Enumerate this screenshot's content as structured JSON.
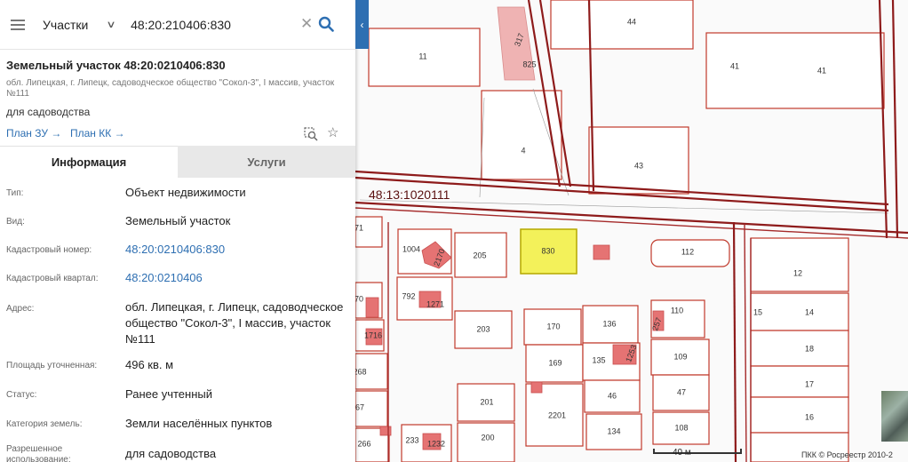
{
  "search": {
    "layer": "Участки",
    "query": "48:20:210406:830"
  },
  "parcel": {
    "title": "Земельный участок 48:20:0210406:830",
    "address_short": "обл. Липецкая, г. Липецк, садоводческое общество \"Сокол-3\", I массив, участок №111",
    "purpose": "для садоводства",
    "plan_zu": "План ЗУ",
    "plan_kk": "План КК"
  },
  "tabs": {
    "info": "Информация",
    "services": "Услуги"
  },
  "info_rows": [
    {
      "key": "Тип:",
      "value": "Объект недвижимости"
    },
    {
      "key": "Вид:",
      "value": "Земельный участок"
    },
    {
      "key": "Кадастровый номер:",
      "value": "48:20:0210406:830"
    },
    {
      "key": "Кадастровый квартал:",
      "value": "48:20:0210406"
    },
    {
      "key": "Адрес:",
      "value": "обл. Липецкая, г. Липецк, садоводческое общество \"Сокол-3\", I массив, участок №111"
    },
    {
      "key": "Площадь уточненная:",
      "value": "496 кв. м"
    },
    {
      "key": "Статус:",
      "value": "Ранее учтенный"
    },
    {
      "key": "Категория земель:",
      "value": "Земли населённых пунктов"
    },
    {
      "key": "Разрешенное использование:",
      "value": "для садоводства"
    }
  ],
  "map": {
    "quarter_label": "48:13:1020111",
    "highlight_parcel": "830",
    "parcels": [
      "44",
      "11",
      "825",
      "317",
      "41",
      "41",
      "4",
      "43",
      "1004",
      "2170",
      "205",
      "830",
      "112",
      "12",
      "71",
      "792",
      "1271",
      "70",
      "203",
      "170",
      "136",
      "110",
      "15",
      "14",
      "1716",
      "169",
      "135",
      "1253",
      "257",
      "109",
      "18",
      "268",
      "201",
      "46",
      "47",
      "17",
      "67",
      "2201",
      "134",
      "108",
      "16",
      "266",
      "233",
      "1232",
      "200"
    ],
    "scale": "40 м",
    "copyright": "ПКК © Росреестр 2010-2"
  },
  "colors": {
    "accent": "#2e6fb2",
    "parcel_border": "#c0392b",
    "highlight_fill": "#f3f15a",
    "building_fill": "#e57373"
  }
}
